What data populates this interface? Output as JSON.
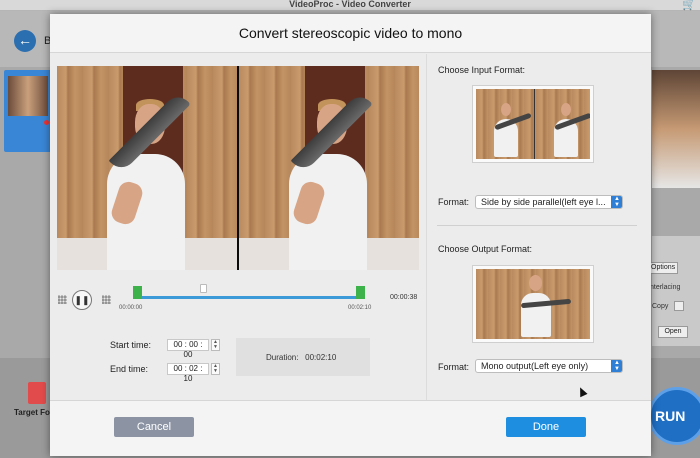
{
  "app": {
    "title": "VideoProc - Video Converter",
    "back_label": "B",
    "target_format_label": "Target For",
    "options_label": "Options",
    "interlacing_label": "nterlacing",
    "copy_label": "Copy",
    "open_label": "Open",
    "run_label": "RUN"
  },
  "dialog": {
    "title": "Convert stereoscopic video to mono",
    "player": {
      "start_time_small": "00:00:00",
      "end_time_small": "00:02:10",
      "total_time": "00:00:38"
    },
    "trim": {
      "start_label": "Start time:",
      "start_value": "00 : 00 : 00",
      "end_label": "End time:",
      "end_value": "00 : 02 : 10",
      "duration_label": "Duration:",
      "duration_value": "00:02:10"
    },
    "input": {
      "title": "Choose Input Format:",
      "format_label": "Format:",
      "format_value": "Side by side parallel(left eye l..."
    },
    "output": {
      "title": "Choose Output Format:",
      "format_label": "Format:",
      "format_value": "Mono output(Left eye only)"
    },
    "buttons": {
      "cancel": "Cancel",
      "done": "Done"
    }
  },
  "icons": {
    "back": "arrow-left-icon",
    "cart": "cart-icon",
    "pause": "pause-icon",
    "select_arrow": "updown-arrow-icon"
  },
  "colors": {
    "accent": "#1e8fe0",
    "trim_handle": "#3db14a",
    "timeline": "#3d9ad9",
    "cancel": "#8c94a4"
  }
}
